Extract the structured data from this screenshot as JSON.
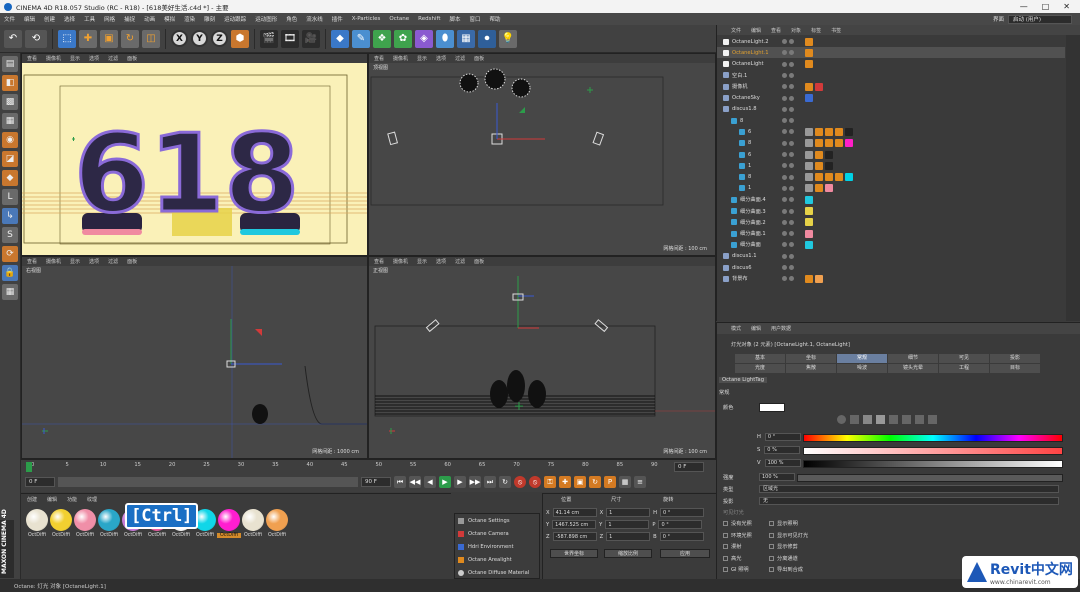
{
  "window": {
    "title": "CINEMA 4D R18.057 Studio (RC - R18) - [618美好生活.c4d *] - 主要",
    "controls": [
      "—",
      "□",
      "✕"
    ]
  },
  "menu": {
    "items": [
      "文件",
      "编辑",
      "创建",
      "选择",
      "工具",
      "网格",
      "捕捉",
      "动画",
      "模拟",
      "渲染",
      "雕刻",
      "运动跟踪",
      "运动图形",
      "角色",
      "流水线",
      "插件",
      "X-Particles",
      "Octane",
      "Redshift",
      "脚本",
      "窗口",
      "帮助"
    ],
    "layout_label": "界面",
    "layout_value": "启动 (用户)"
  },
  "toolbar": {
    "x": "X",
    "y": "Y",
    "z": "Z"
  },
  "viewports": {
    "menu": [
      "查看",
      "摄像机",
      "显示",
      "选项",
      "过滤",
      "面板"
    ],
    "perspective": {
      "name": "",
      "text": "618"
    },
    "top": {
      "name": "顶视图",
      "grid": "网格间距 : 100 cm"
    },
    "right": {
      "name": "右视图",
      "grid": "网格间距 : 1000 cm"
    },
    "front": {
      "name": "正视图",
      "grid": "网格间距 : 100 cm"
    }
  },
  "objects": {
    "menu": [
      "文件",
      "编辑",
      "查看",
      "对象",
      "标签",
      "书签"
    ],
    "rows": [
      {
        "name": "OctaneLight.2",
        "indent": 0
      },
      {
        "name": "OctaneLight.1",
        "indent": 0,
        "selected": true
      },
      {
        "name": "OctaneLight",
        "indent": 0
      },
      {
        "name": "空白.1",
        "indent": 0
      },
      {
        "name": "摄像机",
        "indent": 0
      },
      {
        "name": "OctaneSky",
        "indent": 0
      },
      {
        "name": "discus1.8",
        "indent": 0
      },
      {
        "name": "8",
        "indent": 1
      },
      {
        "name": "6",
        "indent": 2
      },
      {
        "name": "8",
        "indent": 2
      },
      {
        "name": "6",
        "indent": 2
      },
      {
        "name": "1",
        "indent": 2
      },
      {
        "name": "8",
        "indent": 2
      },
      {
        "name": "1",
        "indent": 2
      },
      {
        "name": "细分曲面.4",
        "indent": 1
      },
      {
        "name": "细分曲面.3",
        "indent": 1
      },
      {
        "name": "细分曲面.2",
        "indent": 1
      },
      {
        "name": "细分曲面.1",
        "indent": 1
      },
      {
        "name": "细分曲面",
        "indent": 1
      },
      {
        "name": "discus1.1",
        "indent": 0
      },
      {
        "name": "discus6",
        "indent": 0
      },
      {
        "name": "背景布",
        "indent": 0
      }
    ],
    "colors": {
      "orange": "#e08a1e",
      "magenta": "#ff1ec8",
      "cyan": "#00d2e6",
      "pink": "#f08aa0"
    }
  },
  "attributes": {
    "menu": [
      "模式",
      "编辑",
      "用户数据"
    ],
    "header": "灯光对象 (2 元素) [OctaneLight.1, OctaneLight]",
    "tabs": [
      "基本",
      "坐标",
      "常规",
      "细节",
      "可见",
      "投影",
      "光度",
      "焦散",
      "噪波",
      "镜头光晕",
      "工程",
      "目标"
    ],
    "active_tab": "常规",
    "octane_tag": "Octane LightTag",
    "section": "常规",
    "color_label": "颜色",
    "h_label": "H",
    "h_value": "0 °",
    "s_label": "S",
    "s_value": "0 %",
    "v_label": "V",
    "v_value": "100 %",
    "intensity_label": "强度",
    "intensity_value": "100 %",
    "type_label": "类型",
    "type_value": "区域光",
    "shadow_label": "投影",
    "shadow_value": "无",
    "visible_label": "可见灯光",
    "options_left": [
      "没有光照",
      "环境光照",
      "漫射",
      "高光",
      "GI 照明"
    ],
    "options_right": [
      "显示照明",
      "显示可见灯光",
      "显示修剪",
      "分离通道",
      "导出到合成"
    ]
  },
  "timeline": {
    "ticks": [
      "0",
      "5",
      "10",
      "15",
      "20",
      "25",
      "30",
      "35",
      "40",
      "45",
      "50",
      "55",
      "60",
      "65",
      "70",
      "75",
      "80",
      "85",
      "90"
    ],
    "end_field": "0 F",
    "start_field": "0 F",
    "current_field": "0 F",
    "max_field": "90 F",
    "max2_field": "90 F"
  },
  "materials": {
    "menu": [
      "创建",
      "编辑",
      "功能",
      "纹理"
    ],
    "items": [
      {
        "label": "OctDiffi",
        "color": "#e8e2d0"
      },
      {
        "label": "OctDiffi",
        "color": "#f2d030"
      },
      {
        "label": "OctDiffi",
        "color": "#f08fa8"
      },
      {
        "label": "OctDiffi",
        "color": "#2aa6c8"
      },
      {
        "label": "OctDiffi",
        "color": "#c77ad8"
      },
      {
        "label": "OctDiffi",
        "color": "#e65aa0"
      },
      {
        "label": "OctDiffi",
        "color": "#f4f4f4"
      },
      {
        "label": "OctDiffi",
        "color": "#10d6e8"
      },
      {
        "label": "OctDiffi",
        "color": "#ff1ed0",
        "selected": true
      },
      {
        "label": "OctDiffi",
        "color": "#e8e2d0"
      },
      {
        "label": "OctDiffi",
        "color": "#f0a050"
      }
    ],
    "ctrl_overlay": "[Ctrl]"
  },
  "octane_menu": [
    "Octane Settings",
    "Octane Camera",
    "Hdri Environment",
    "Octane Arealight",
    "Octane Diffuse Material"
  ],
  "coordinates": {
    "headers": [
      "位置",
      "尺寸",
      "旋转"
    ],
    "rows": [
      {
        "axis": "X",
        "pos": "41.14 cm",
        "size_axis": "X",
        "size": "1",
        "rot_axis": "H",
        "rot": "0 °"
      },
      {
        "axis": "Y",
        "pos": "1467.525 cm",
        "size_axis": "Y",
        "size": "1",
        "rot_axis": "P",
        "rot": "0 °"
      },
      {
        "axis": "Z",
        "pos": "-587.898 cm",
        "size_axis": "Z",
        "size": "1",
        "rot_axis": "B",
        "rot": "0 °"
      }
    ],
    "mode_world": "世界坐标",
    "mode_scale": "缩放比例",
    "apply": "应用"
  },
  "statusbar": "Octane:      灯光 对象 [OctaneLight.1]",
  "brand": "MAXON CINEMA 4D",
  "watermark": {
    "main": "Revit中文网",
    "sub": "www.chinarevit.com"
  }
}
